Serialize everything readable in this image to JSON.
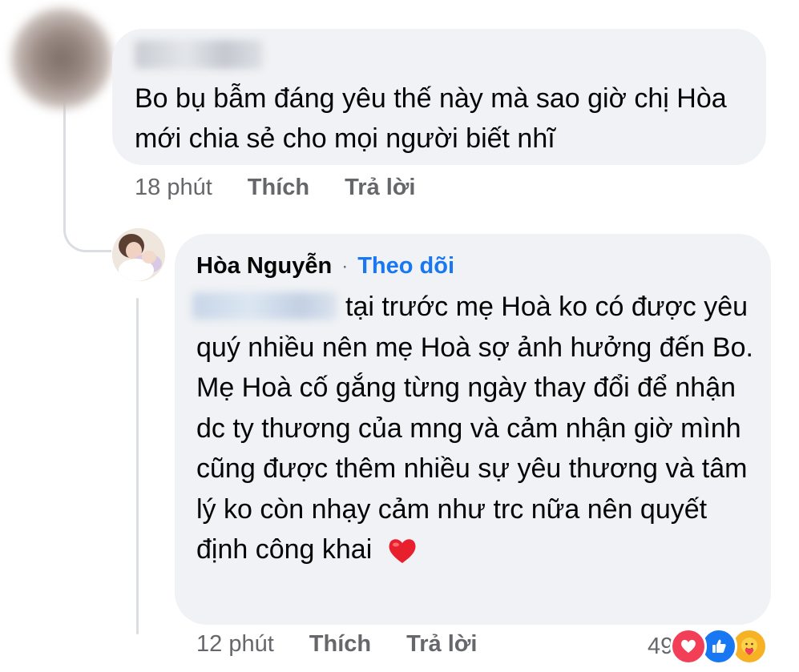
{
  "comment": {
    "author_name": "",
    "text": "Bo bụ bẫm đáng yêu thế này mà sao giờ chị Hòa mới chia sẻ cho mọi người biết nhĩ",
    "time": "18 phút",
    "like_label": "Thích",
    "reply_label": "Trả lời"
  },
  "reply": {
    "author_name": "Hòa Nguyễn",
    "separator": "·",
    "follow_label": "Theo dõi",
    "text": "tại trước mẹ Hoà ko có được yêu quý nhiều nên mẹ Hoà sợ ảnh hưởng đến Bo. Mẹ Hoà cố gắng từng ngày thay đổi để nhận dc ty thương của mng và cảm nhận giờ mình cũng được thêm nhiều sự yêu thương và tâm lý ko còn nhạy cảm như trc nữa nên quyết định công khai",
    "trailing_emoji": "red-heart-emoji",
    "time": "12 phút",
    "like_label": "Thích",
    "reply_label": "Trả lời",
    "reaction_count": "49",
    "reaction_icons": [
      "love-reaction-icon",
      "like-reaction-icon",
      "care-reaction-icon"
    ]
  },
  "colors": {
    "bubble": "#f0f2f5",
    "meta_text": "#65676b",
    "link": "#1877f2",
    "thread_line": "#dadde1",
    "love": "#f33e58",
    "like": "#1877f2",
    "care": "#f7b125"
  }
}
